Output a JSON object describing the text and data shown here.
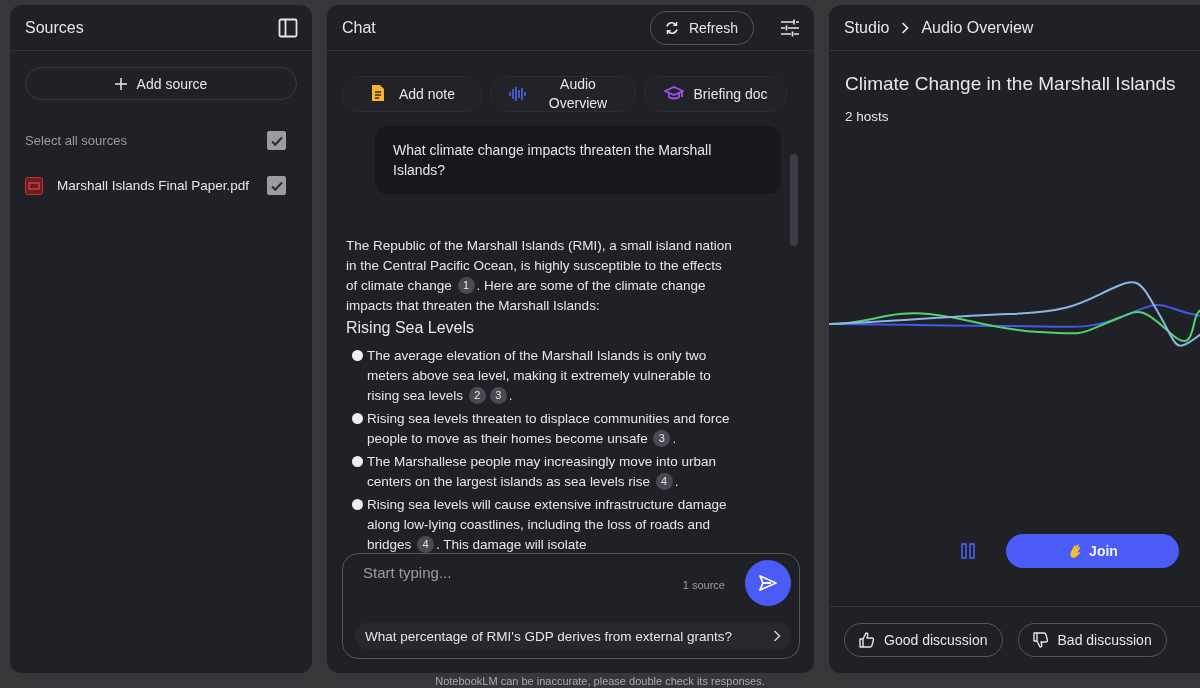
{
  "sources_panel": {
    "title": "Sources",
    "add_button": "Add source",
    "select_all": {
      "label": "Select all sources",
      "checked": true
    },
    "sources": [
      {
        "name": "Marshall Islands Final Paper.pdf",
        "checked": true
      }
    ]
  },
  "chat": {
    "title": "Chat",
    "refresh_button": "Refresh",
    "actions": [
      {
        "kind": "note",
        "label": "Add note"
      },
      {
        "kind": "audio",
        "label": "Audio Overview"
      },
      {
        "kind": "briefing",
        "label": "Briefing doc"
      }
    ],
    "question": "What climate change impacts threaten the Marshall Islands?",
    "answer": {
      "intro": [
        {
          "text": "The Republic of the Marshall Islands (RMI), a small island nation in the Central Pacific Ocean, is highly susceptible to the effects of climate change "
        },
        {
          "cite": "1"
        },
        {
          "text": ". Here are some of the climate change impacts that threaten the Marshall Islands:"
        }
      ],
      "heading": "Rising Sea Levels",
      "bullets": [
        [
          {
            "text": "The average elevation of the Marshall Islands is only two meters above sea level, making it extremely vulnerable to rising sea levels "
          },
          {
            "cite": "2"
          },
          {
            "cite": "3"
          },
          {
            "text": "."
          }
        ],
        [
          {
            "text": "Rising sea levels threaten to displace communities and force people to move as their homes become unsafe "
          },
          {
            "cite": "3"
          },
          {
            "text": "."
          }
        ],
        [
          {
            "text": "The Marshallese people may increasingly move into urban centers on the largest islands as sea levels rise "
          },
          {
            "cite": "4"
          },
          {
            "text": "."
          }
        ],
        [
          {
            "text": "Rising sea levels will cause extensive infrastructure damage along low-lying coastlines, including the loss of roads and bridges "
          },
          {
            "cite": "4"
          },
          {
            "text": ". This damage will isolate"
          }
        ]
      ]
    },
    "input": {
      "placeholder": "Start typing...",
      "source_count": "1 source"
    },
    "suggestion": "What percentage of RMI's GDP derives from external grants?"
  },
  "studio": {
    "breadcrumb": [
      "Studio",
      "Audio Overview"
    ],
    "title": "Climate Change in the Marshall Islands",
    "hosts": "2 hosts",
    "playing": true,
    "join_button": "Join",
    "feedback": [
      {
        "kind": "good",
        "label": "Good discussion"
      },
      {
        "kind": "bad",
        "label": "Bad discussion"
      }
    ]
  },
  "footer": "NotebookLM can be inaccurate, please double check its responses."
}
